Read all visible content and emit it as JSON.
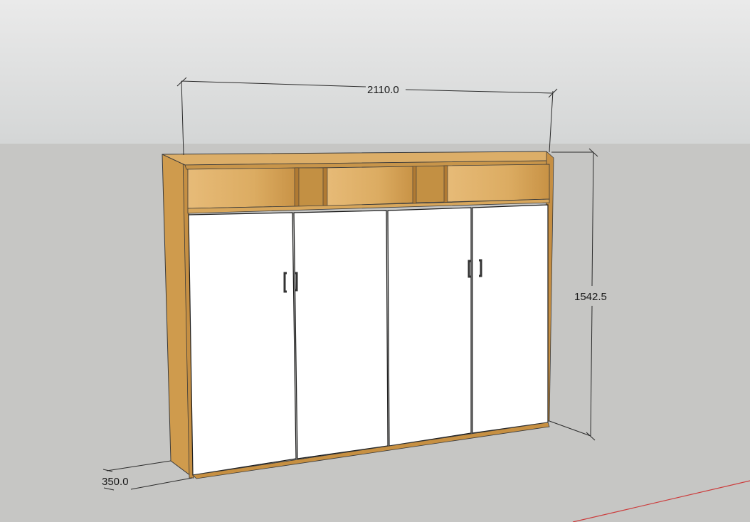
{
  "dimensions": {
    "width_label": "2110.0",
    "height_label": "1542.5",
    "depth_label": "350.0"
  },
  "colors": {
    "sky": "#dcdede",
    "ground": "#c6c6c4",
    "wood": "#d9a657",
    "wood_dark": "#b8843c",
    "door": "#ffffff",
    "dimension_line": "#2a2a2a",
    "axis_red": "#cc3b3b"
  },
  "cabinet": {
    "open_compartments": 5,
    "doors": 4,
    "handles": 2
  }
}
